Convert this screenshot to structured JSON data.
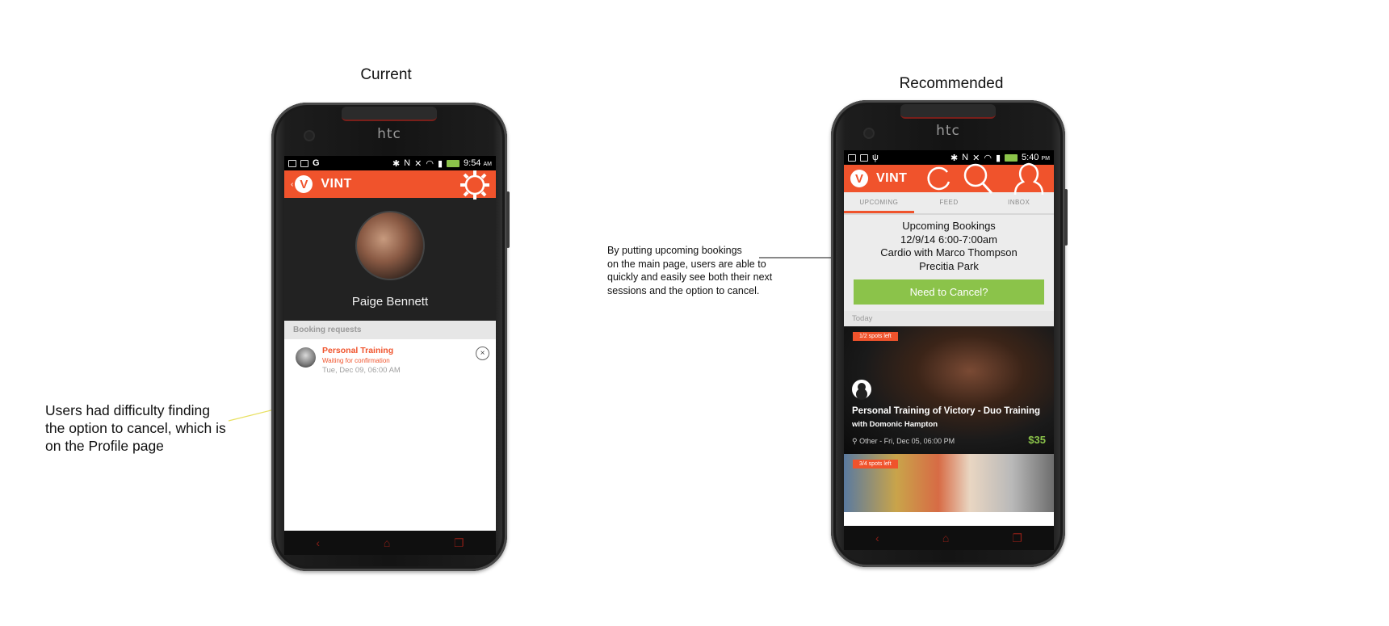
{
  "captions": {
    "current": "Current",
    "recommended": "Recommended"
  },
  "notes": {
    "left": [
      "Users had difficulty finding",
      "the option to cancel, which is",
      "on the Profile page"
    ],
    "right": [
      "By putting upcoming bookings",
      "on the main page, users are able to",
      "quickly and easily see both their next",
      "sessions and the option to cancel."
    ]
  },
  "phone_brand": "htc",
  "colors": {
    "accent": "#f0532c",
    "success": "#8bc34a"
  },
  "current": {
    "status_time": "9:54",
    "status_ampm": "AM",
    "app_logo": "V",
    "app_name": "VINT",
    "app_icon": "gear-icon",
    "profile_name": "Paige Bennett",
    "section_title": "Booking requests",
    "request": {
      "title": "Personal Training",
      "status": "Waiting for confirmation",
      "date": "Tue, Dec 09, 06:00 AM",
      "close": "×"
    }
  },
  "recommended": {
    "status_time": "5:40",
    "status_ampm": "PM",
    "app_logo": "V",
    "app_name": "VINT",
    "icons": [
      "refresh-icon",
      "search-icon",
      "profile-icon"
    ],
    "tabs": [
      {
        "label": "UPCOMING",
        "active": true
      },
      {
        "label": "FEED",
        "active": false
      },
      {
        "label": "INBOX",
        "active": false
      }
    ],
    "upcoming": {
      "title": "Upcoming Bookings",
      "datetime": "12/9/14 6:00-7:00am",
      "session": "Cardio with Marco Thompson",
      "location": "Precitia Park",
      "cancel_label": "Need to Cancel?"
    },
    "today_label": "Today",
    "cards": [
      {
        "spots": "1/2 spots left",
        "title": "Personal Training of Victory - Duo Training",
        "trainer": "with Domonic Hampton",
        "meta": "Other - Fri, Dec 05, 06:00 PM",
        "price": "$35"
      },
      {
        "spots": "3/4 spots left"
      }
    ]
  }
}
